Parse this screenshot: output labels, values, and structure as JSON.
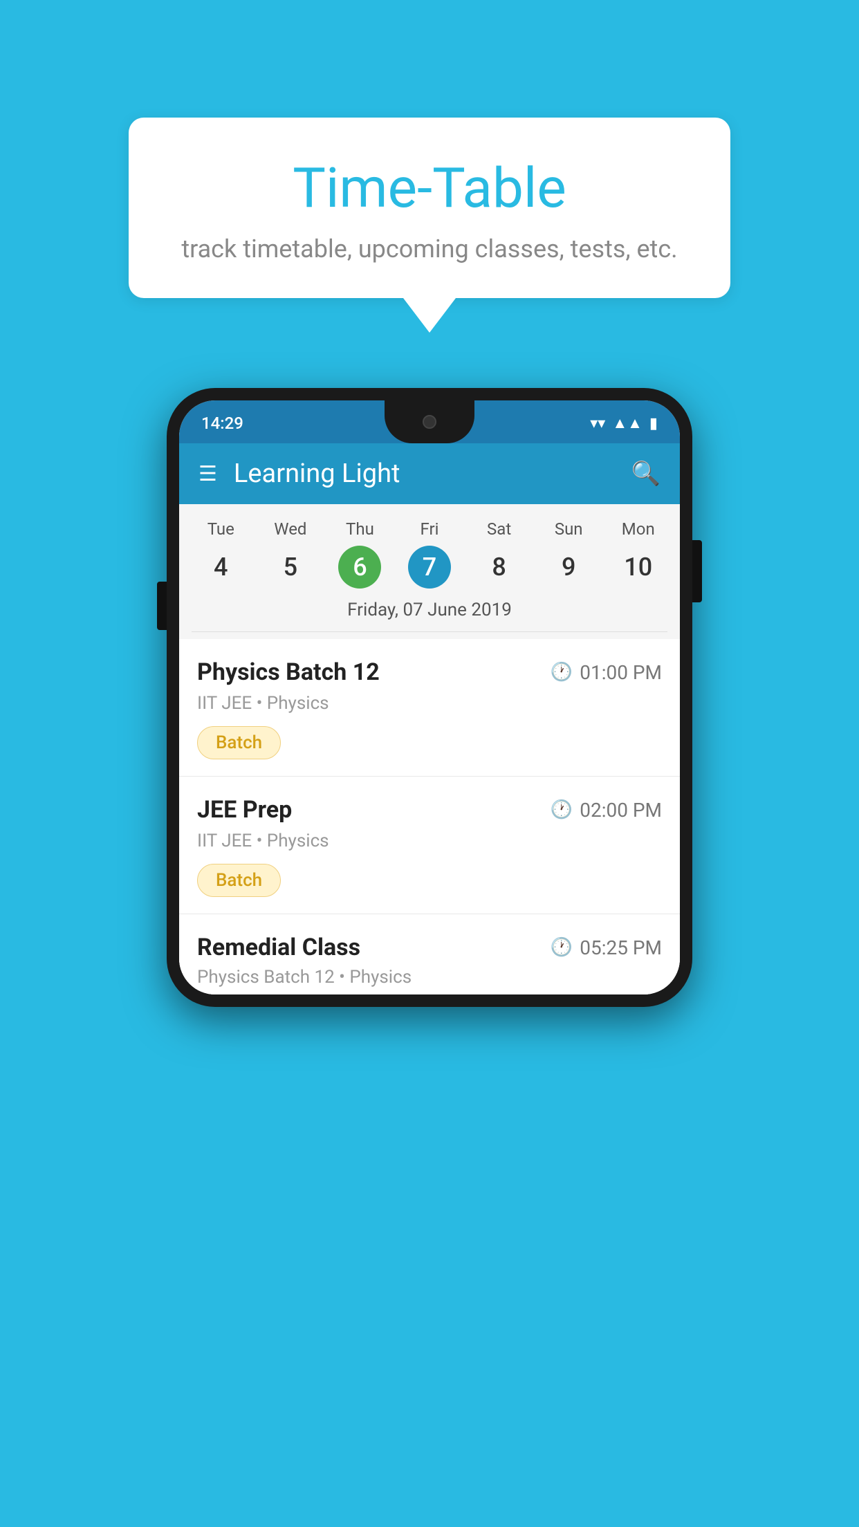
{
  "background_color": "#29BAE2",
  "speech_bubble": {
    "title": "Time-Table",
    "subtitle": "track timetable, upcoming classes, tests, etc."
  },
  "phone": {
    "status_bar": {
      "time": "14:29"
    },
    "app_bar": {
      "title": "Learning Light"
    },
    "calendar": {
      "days": [
        {
          "name": "Tue",
          "number": "4",
          "state": "normal"
        },
        {
          "name": "Wed",
          "number": "5",
          "state": "normal"
        },
        {
          "name": "Thu",
          "number": "6",
          "state": "today"
        },
        {
          "name": "Fri",
          "number": "7",
          "state": "selected"
        },
        {
          "name": "Sat",
          "number": "8",
          "state": "normal"
        },
        {
          "name": "Sun",
          "number": "9",
          "state": "normal"
        },
        {
          "name": "Mon",
          "number": "10",
          "state": "normal"
        }
      ],
      "selected_date_label": "Friday, 07 June 2019"
    },
    "classes": [
      {
        "name": "Physics Batch 12",
        "time": "01:00 PM",
        "meta": "IIT JEE • Physics",
        "tag": "Batch"
      },
      {
        "name": "JEE Prep",
        "time": "02:00 PM",
        "meta": "IIT JEE • Physics",
        "tag": "Batch"
      },
      {
        "name": "Remedial Class",
        "time": "05:25 PM",
        "meta_partial": "Physics Batch 12 • Physics"
      }
    ]
  }
}
